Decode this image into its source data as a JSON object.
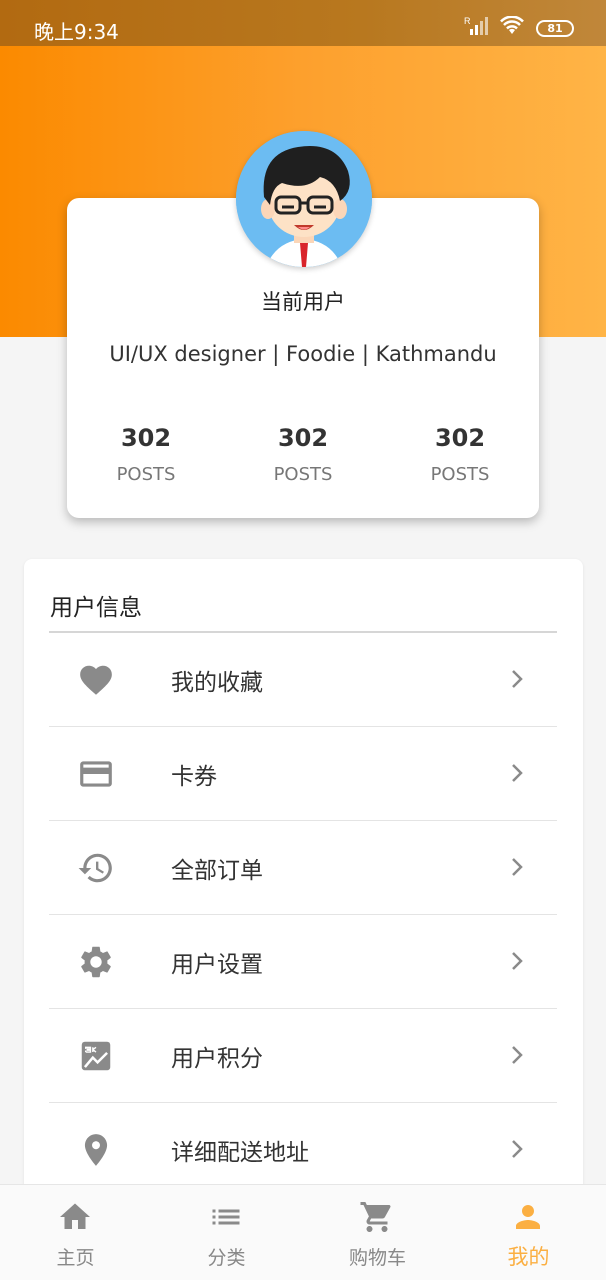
{
  "status_bar": {
    "time": "晚上9:34",
    "battery": "81",
    "network_label": "R"
  },
  "profile": {
    "name": "当前用户",
    "bio": "UI/UX designer | Foodie | Kathmandu",
    "stats": [
      {
        "value": "302",
        "label": "POSTS"
      },
      {
        "value": "302",
        "label": "POSTS"
      },
      {
        "value": "302",
        "label": "POSTS"
      }
    ]
  },
  "user_info": {
    "title": "用户信息",
    "items": [
      {
        "label": "我的收藏",
        "icon": "heart-icon"
      },
      {
        "label": "卡券",
        "icon": "credit-card-icon"
      },
      {
        "label": "全部订单",
        "icon": "history-icon"
      },
      {
        "label": "用户设置",
        "icon": "gear-icon"
      },
      {
        "label": "用户积分",
        "icon": "points-icon"
      },
      {
        "label": "详细配送地址",
        "icon": "location-pin-icon"
      }
    ]
  },
  "bottom_nav": {
    "items": [
      {
        "label": "主页",
        "icon": "home-icon"
      },
      {
        "label": "分类",
        "icon": "list-icon"
      },
      {
        "label": "购物车",
        "icon": "cart-icon"
      },
      {
        "label": "我的",
        "icon": "person-icon",
        "active": true
      }
    ]
  },
  "colors": {
    "accent": "#fbaf42",
    "header_gradient_start": "#fb8a00",
    "header_gradient_end": "#ffb446",
    "icon_gray": "#8a8a8a"
  }
}
